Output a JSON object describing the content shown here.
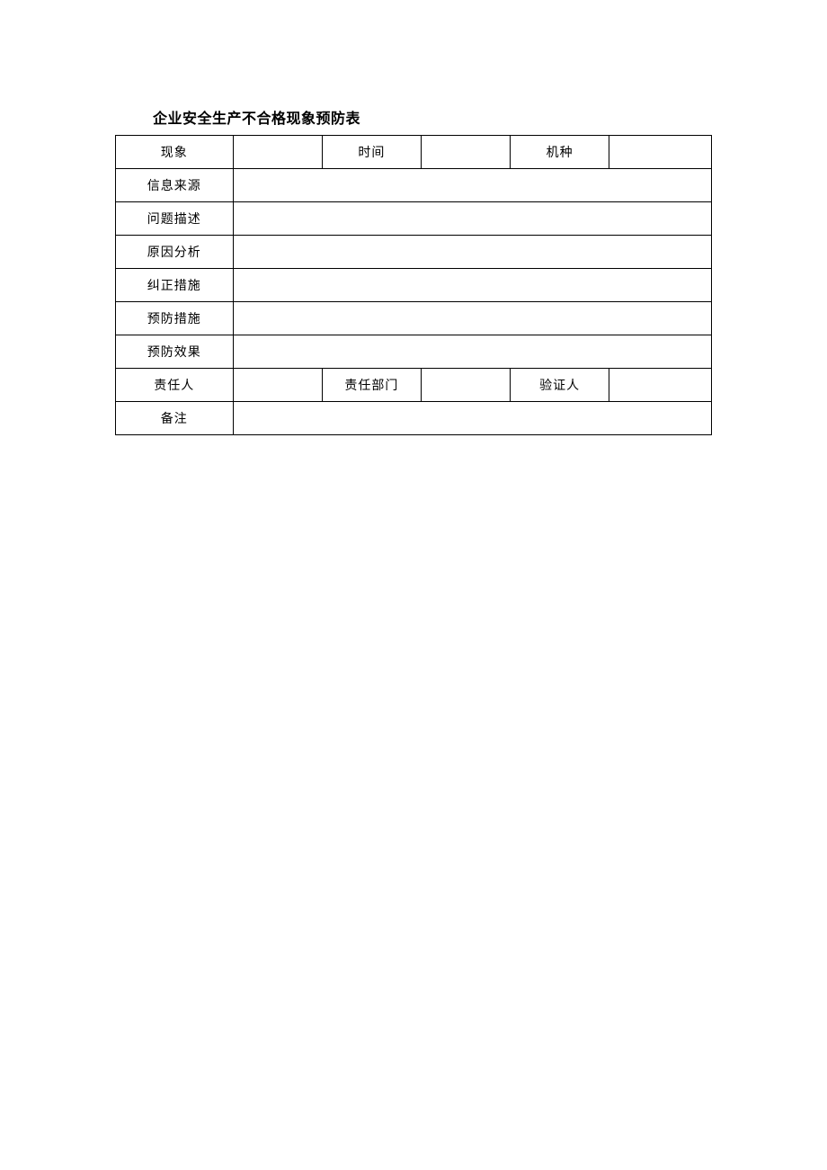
{
  "title": "企业安全生产不合格现象预防表",
  "row1": {
    "phenomenon_label": "现象",
    "phenomenon_value": "",
    "time_label": "时间",
    "time_value": "",
    "machine_label": "机种",
    "machine_value": ""
  },
  "rows_full": {
    "info_source_label": "信息来源",
    "info_source_value": "",
    "problem_desc_label": "问题描述",
    "problem_desc_value": "",
    "cause_analysis_label": "原因分析",
    "cause_analysis_value": "",
    "corrective_action_label": "纠正措施",
    "corrective_action_value": "",
    "preventive_action_label": "预防措施",
    "preventive_action_value": "",
    "preventive_effect_label": "预防效果",
    "preventive_effect_value": ""
  },
  "row_resp": {
    "responsible_person_label": "责任人",
    "responsible_person_value": "",
    "responsible_dept_label": "责任部门",
    "responsible_dept_value": "",
    "verifier_label": "验证人",
    "verifier_value": ""
  },
  "row_remark": {
    "remark_label": "备注",
    "remark_value": ""
  }
}
